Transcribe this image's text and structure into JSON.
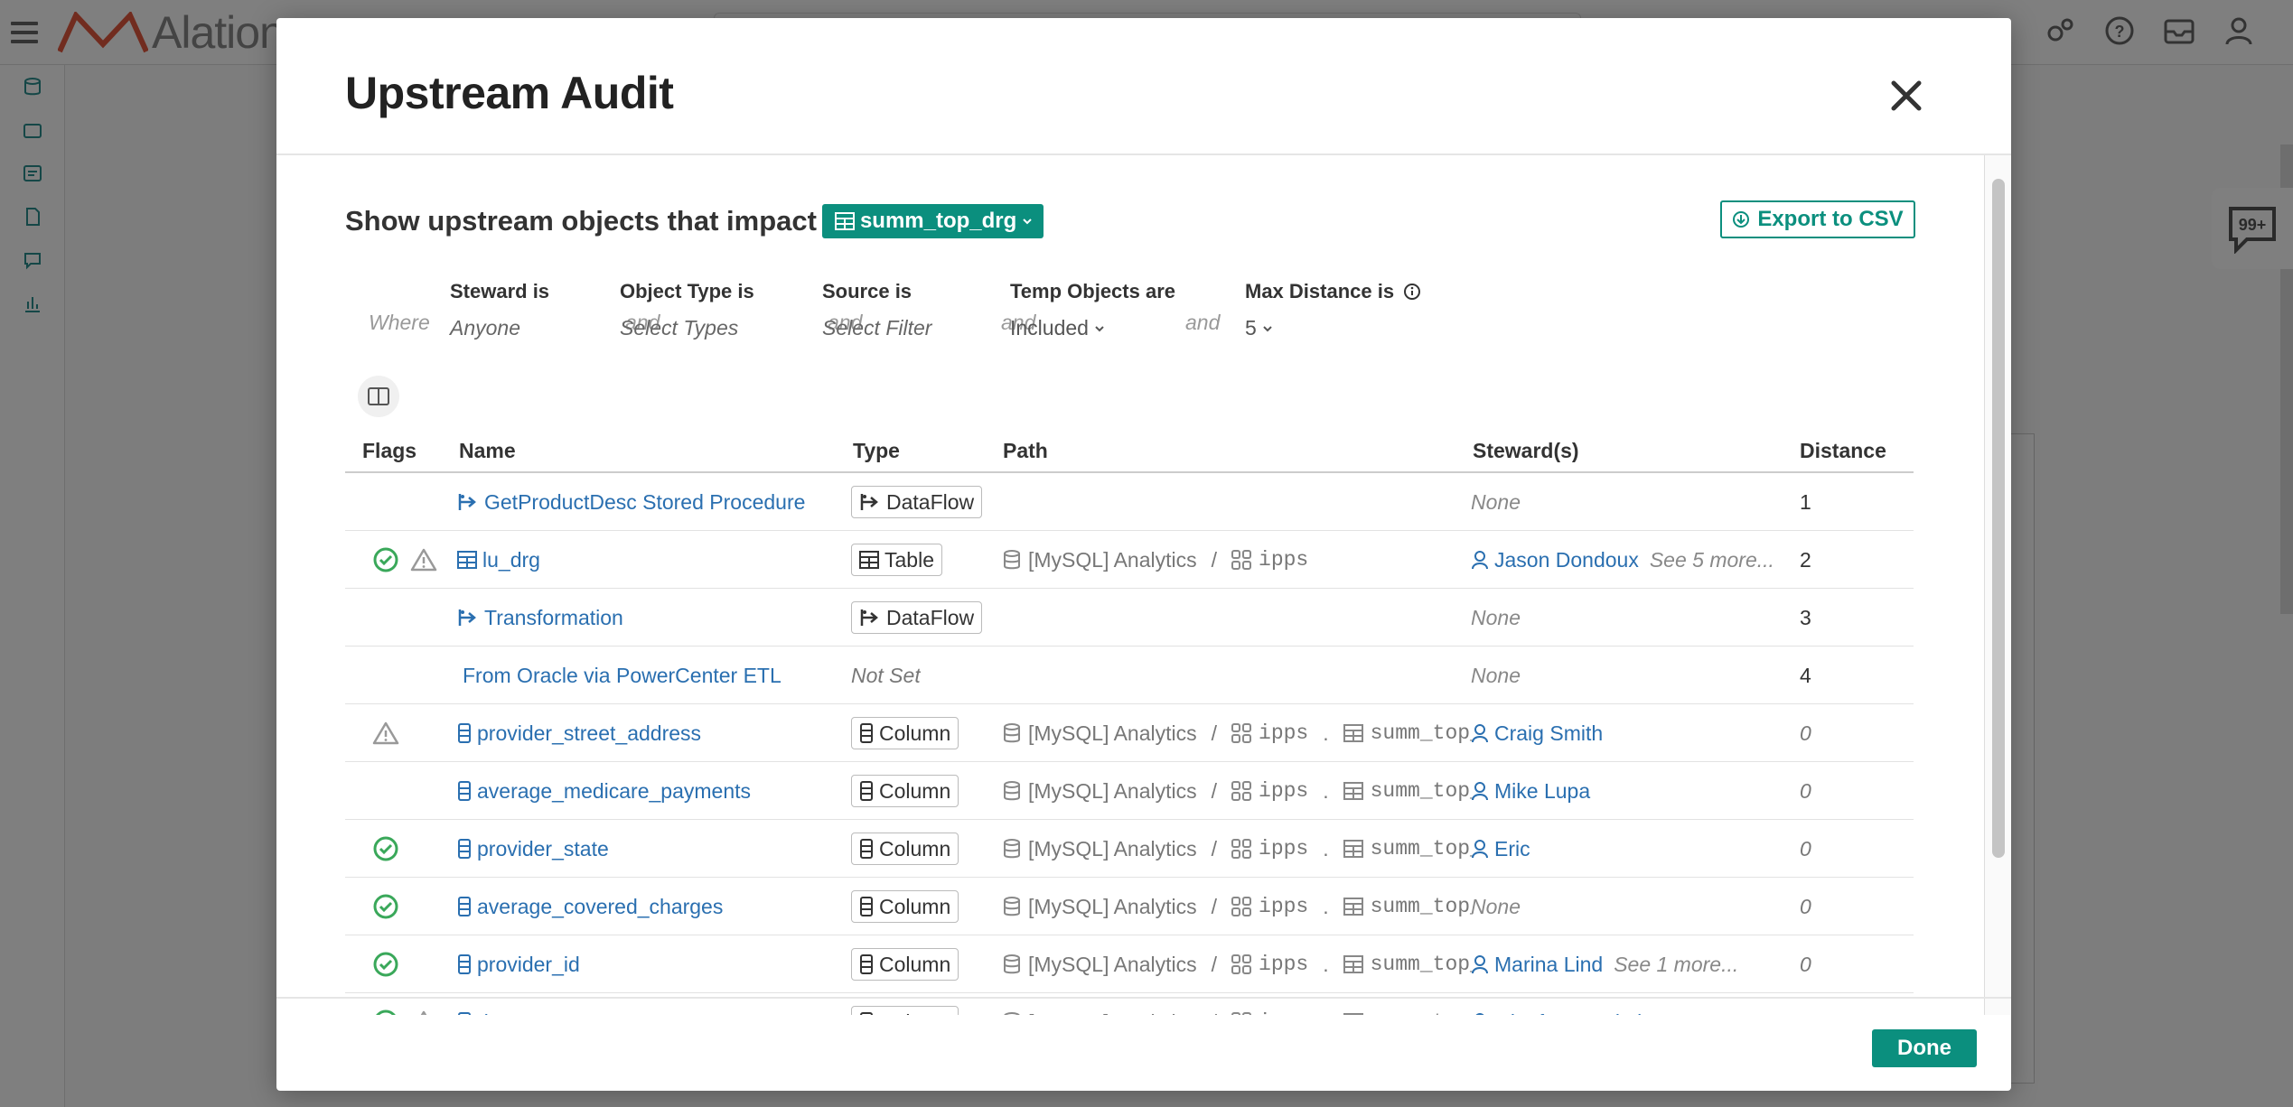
{
  "app": {
    "logo_text": "Alation",
    "chat_badge": "99+"
  },
  "modal": {
    "title": "Upstream Audit",
    "impact_label": "Show upstream objects that impact",
    "object_name": "summ_top_drg",
    "export_label": "Export to CSV",
    "done_label": "Done"
  },
  "filters": {
    "where_label": "Where",
    "and_label": "and",
    "steward": {
      "label": "Steward is",
      "value": "Anyone"
    },
    "object_type": {
      "label": "Object Type is",
      "value": "Select Types"
    },
    "source": {
      "label": "Source is",
      "value": "Select Filter"
    },
    "temp_objects": {
      "label": "Temp Objects are",
      "value": "Included"
    },
    "max_distance": {
      "label": "Max Distance is",
      "value": "5"
    }
  },
  "table": {
    "headers": {
      "flags": "Flags",
      "name": "Name",
      "type": "Type",
      "path": "Path",
      "stewards": "Steward(s)",
      "distance": "Distance"
    },
    "rows": [
      {
        "endorsed": false,
        "warning": false,
        "icon": "dataflow-icon",
        "name": "GetProductDesc Stored Procedure",
        "type": "DataFlow",
        "type_icon": "dataflow-icon",
        "path_source": "",
        "path_schema": "",
        "path_table": "",
        "steward": "",
        "steward_more": "",
        "none": "None",
        "distance": "1"
      },
      {
        "endorsed": true,
        "warning": true,
        "icon": "table-icon",
        "name": "lu_drg",
        "type": "Table",
        "type_icon": "table-icon",
        "path_source": "[MySQL] Analytics",
        "path_schema": "ipps",
        "path_table": "",
        "steward": "Jason Dondoux",
        "steward_more": "See 5 more...",
        "none": "",
        "distance": "2"
      },
      {
        "endorsed": false,
        "warning": false,
        "icon": "dataflow-icon",
        "name": "Transformation",
        "type": "DataFlow",
        "type_icon": "dataflow-icon",
        "path_source": "",
        "path_schema": "",
        "path_table": "",
        "steward": "",
        "steward_more": "",
        "none": "None",
        "distance": "3"
      },
      {
        "endorsed": false,
        "warning": false,
        "icon": "",
        "name": "From Oracle via PowerCenter ETL",
        "type": "Not Set",
        "type_icon": "",
        "path_source": "",
        "path_schema": "",
        "path_table": "",
        "steward": "",
        "steward_more": "",
        "none": "None",
        "distance": "4"
      },
      {
        "endorsed": false,
        "warning": true,
        "icon": "column-icon",
        "name": "provider_street_address",
        "type": "Column",
        "type_icon": "column-icon",
        "path_source": "[MySQL] Analytics",
        "path_schema": "ipps",
        "path_table": "summ_top_drg",
        "steward": "Craig Smith",
        "steward_more": "",
        "none": "",
        "distance": "0"
      },
      {
        "endorsed": false,
        "warning": false,
        "icon": "column-icon",
        "name": "average_medicare_payments",
        "type": "Column",
        "type_icon": "column-icon",
        "path_source": "[MySQL] Analytics",
        "path_schema": "ipps",
        "path_table": "summ_top_drg",
        "steward": "Mike Lupa",
        "steward_more": "",
        "none": "",
        "distance": "0"
      },
      {
        "endorsed": true,
        "warning": false,
        "icon": "column-icon",
        "name": "provider_state",
        "type": "Column",
        "type_icon": "column-icon",
        "path_source": "[MySQL] Analytics",
        "path_schema": "ipps",
        "path_table": "summ_top_drg",
        "steward": "Eric",
        "steward_more": "",
        "none": "",
        "distance": "0"
      },
      {
        "endorsed": true,
        "warning": false,
        "icon": "column-icon",
        "name": "average_covered_charges",
        "type": "Column",
        "type_icon": "column-icon",
        "path_source": "[MySQL] Analytics",
        "path_schema": "ipps",
        "path_table": "summ_top_drg",
        "steward": "",
        "steward_more": "",
        "none": "None",
        "distance": "0"
      },
      {
        "endorsed": true,
        "warning": false,
        "icon": "column-icon",
        "name": "provider_id",
        "type": "Column",
        "type_icon": "column-icon",
        "path_source": "[MySQL] Analytics",
        "path_schema": "ipps",
        "path_table": "summ_top_drg",
        "steward": "Marina Lind",
        "steward_more": "See 1 more...",
        "none": "",
        "distance": "0"
      },
      {
        "endorsed": true,
        "warning": true,
        "icon": "column-icon",
        "name": "drg",
        "type": "Column",
        "type_icon": "column-icon",
        "path_source": "[MySQL] Analytics",
        "path_schema": "ipps",
        "path_table": "summ_top_drg",
        "steward": "Gianfranco Vitale",
        "steward_more": "",
        "none": "",
        "distance": "0"
      }
    ]
  },
  "colors": {
    "accent": "#0b8f7e",
    "link": "#2a6fb0",
    "endorsed": "#3aa85a",
    "warning": "#999999"
  }
}
